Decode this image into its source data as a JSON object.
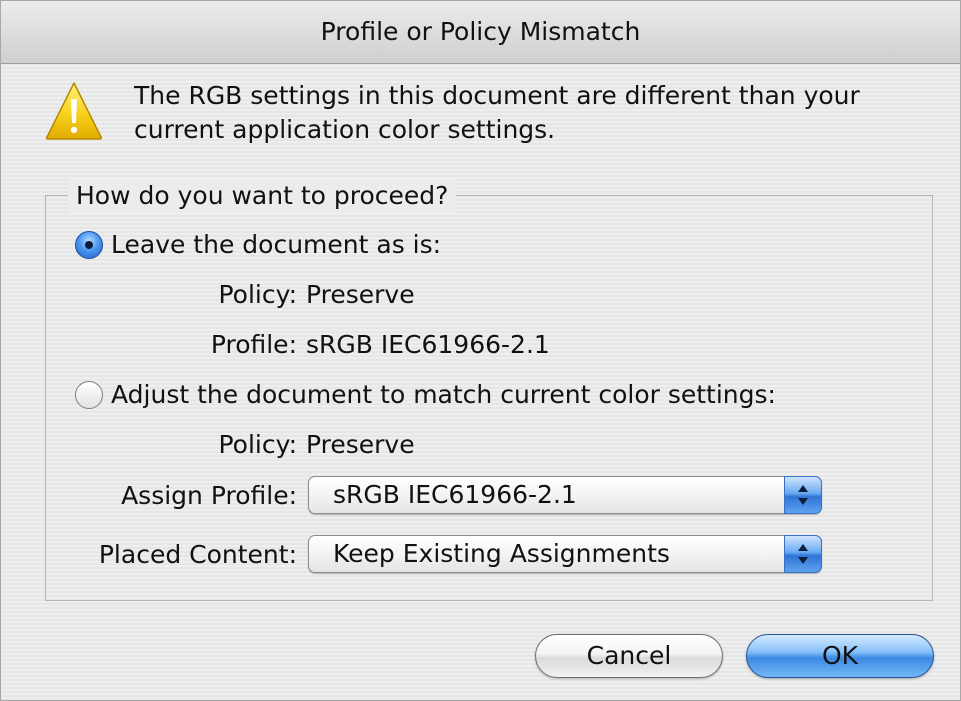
{
  "window": {
    "title": "Profile or Policy Mismatch"
  },
  "alert": {
    "icon": "warning-icon",
    "message_line1": "The RGB settings in this document are different than your",
    "message_line2": "current application color settings."
  },
  "proceed_group": {
    "legend": "How do you want to proceed?",
    "leave_option": {
      "label": "Leave the document as is:",
      "selected": true,
      "policy_label": "Policy:",
      "policy_value": "Preserve",
      "profile_label": "Profile:",
      "profile_value": "sRGB IEC61966-2.1"
    },
    "adjust_option": {
      "label": "Adjust the document to match current color settings:",
      "selected": false,
      "policy_label": "Policy:",
      "policy_value": "Preserve",
      "assign_profile_label": "Assign Profile:",
      "assign_profile_value": "sRGB IEC61966-2.1",
      "placed_content_label": "Placed Content:",
      "placed_content_value": "Keep Existing Assignments"
    }
  },
  "buttons": {
    "cancel_label": "Cancel",
    "ok_label": "OK"
  },
  "colors": {
    "accent_blue": "#3d89e3",
    "warning_yellow": "#f5c400"
  }
}
